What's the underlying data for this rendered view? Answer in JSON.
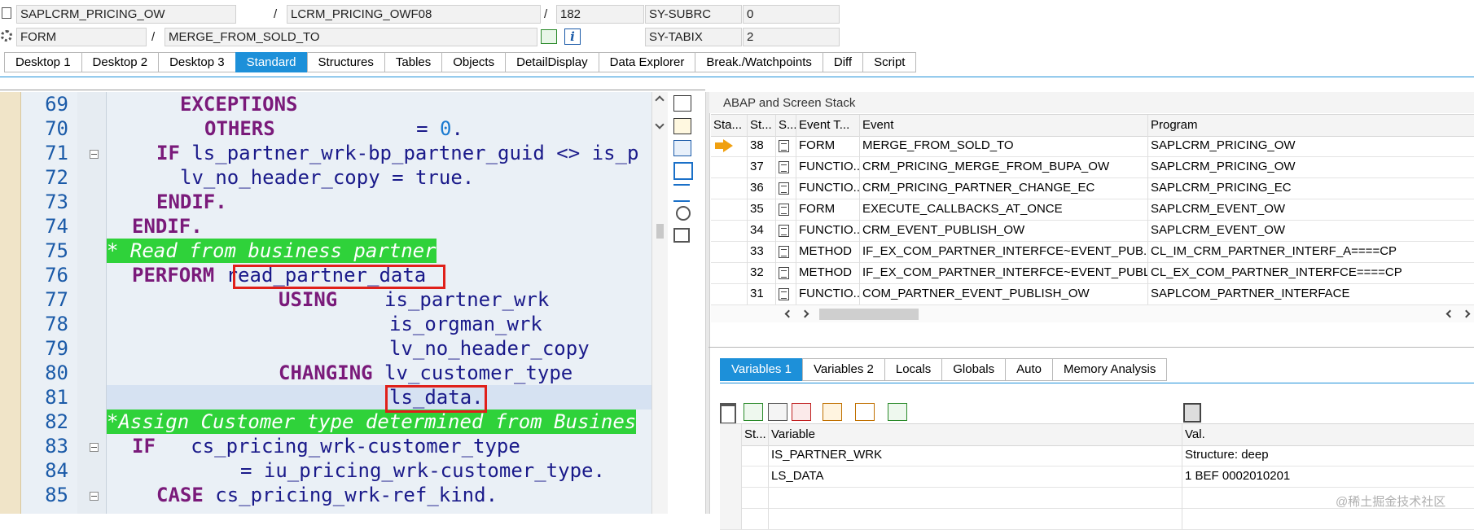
{
  "header": {
    "row1": {
      "program": "SAPLCRM_PRICING_OW",
      "include": "LCRM_PRICING_OWF08",
      "line": "182",
      "sysvar_label": "SY-SUBRC",
      "sysvar_value": "0"
    },
    "row2": {
      "type": "FORM",
      "name": "MERGE_FROM_SOLD_TO",
      "sysvar_label": "SY-TABIX",
      "sysvar_value": "2"
    },
    "slash": "/"
  },
  "tabs": [
    "Desktop 1",
    "Desktop 2",
    "Desktop 3",
    "Standard",
    "Structures",
    "Tables",
    "Objects",
    "DetailDisplay",
    "Data Explorer",
    "Break./Watchpoints",
    "Diff",
    "Script"
  ],
  "active_tab": "Standard",
  "code": {
    "lines": [
      {
        "n": "69",
        "t": "EXCEPTIONS"
      },
      {
        "n": "70",
        "t": "OTHERS            = 0."
      },
      {
        "n": "71",
        "t": "IF ls_partner_wrk-bp_partner_guid <> is_p"
      },
      {
        "n": "72",
        "t": "lv_no_header_copy = true."
      },
      {
        "n": "73",
        "t": "ENDIF."
      },
      {
        "n": "74",
        "t": "ENDIF."
      },
      {
        "n": "75",
        "t": "* Read from business partner"
      },
      {
        "n": "76",
        "t": "PERFORM read_partner_data"
      },
      {
        "n": "77",
        "t": "USING    is_partner_wrk"
      },
      {
        "n": "78",
        "t": "is_orgman_wrk"
      },
      {
        "n": "79",
        "t": "lv_no_header_copy"
      },
      {
        "n": "80",
        "t": "CHANGING lv_customer_type"
      },
      {
        "n": "81",
        "t": "ls_data."
      },
      {
        "n": "82",
        "t": "*Assign Customer type determined from Busines"
      },
      {
        "n": "83",
        "t": "IF   cs_pricing_wrk-customer_type"
      },
      {
        "n": "84",
        "t": "= iu_pricing_wrk-customer_type."
      },
      {
        "n": "85",
        "t": "CASE cs_pricing_wrk-ref_kind."
      }
    ],
    "kw": {
      "exceptions": "EXCEPTIONS",
      "others": "OTHERS",
      "others_rest": "            = ",
      "zero": "0",
      "dot": ".",
      "if": "IF",
      "if71_rest": " ls_partner_wrk-bp_partner_guid <> is_p",
      "l72": "lv_no_header_copy = true.",
      "endif": "ENDIF.",
      "c75": "* Read from business partner",
      "perform": "PERFORM",
      "form_name": "read_partner_data",
      "using": "USING",
      "using_rest": "    is_partner_wrk",
      "l78": "is_orgman_wrk",
      "l79": "lv_no_header_copy",
      "changing": "CHANGING",
      "changing_rest": " lv_customer_type",
      "l81": "ls_data.",
      "c82": "*Assign Customer type determined from Busines",
      "if83_rest": "   cs_pricing_wrk-customer_type",
      "l84": "= iu_pricing_wrk-customer_type.",
      "case": "CASE",
      "case_rest": " cs_pricing_wrk-ref_kind."
    }
  },
  "stack": {
    "title": "ABAP and Screen Stack",
    "columns": [
      "Sta...",
      "St...",
      "S...",
      "Event T...",
      "Event",
      "Program"
    ],
    "rows": [
      {
        "level": "38",
        "etype": "FORM",
        "event": "MERGE_FROM_SOLD_TO",
        "program": "SAPLCRM_PRICING_OW",
        "current": true
      },
      {
        "level": "37",
        "etype": "FUNCTIO...",
        "event": "CRM_PRICING_MERGE_FROM_BUPA_OW",
        "program": "SAPLCRM_PRICING_OW"
      },
      {
        "level": "36",
        "etype": "FUNCTIO...",
        "event": "CRM_PRICING_PARTNER_CHANGE_EC",
        "program": "SAPLCRM_PRICING_EC"
      },
      {
        "level": "35",
        "etype": "FORM",
        "event": "EXECUTE_CALLBACKS_AT_ONCE",
        "program": "SAPLCRM_EVENT_OW"
      },
      {
        "level": "34",
        "etype": "FUNCTIO...",
        "event": "CRM_EVENT_PUBLISH_OW",
        "program": "SAPLCRM_EVENT_OW"
      },
      {
        "level": "33",
        "etype": "METHOD",
        "event": "IF_EX_COM_PARTNER_INTERFCE~EVENT_PUB...",
        "program": "CL_IM_CRM_PARTNER_INTERF_A====CP"
      },
      {
        "level": "32",
        "etype": "METHOD",
        "event": "IF_EX_COM_PARTNER_INTERFCE~EVENT_PUBL",
        "program": "CL_EX_COM_PARTNER_INTERFCE====CP"
      },
      {
        "level": "31",
        "etype": "FUNCTIO...",
        "event": "COM_PARTNER_EVENT_PUBLISH_OW",
        "program": "SAPLCOM_PARTNER_INTERFACE"
      }
    ]
  },
  "var_tabs": [
    "Variables 1",
    "Variables 2",
    "Locals",
    "Globals",
    "Auto",
    "Memory Analysis"
  ],
  "active_var_tab": "Variables 1",
  "variables": {
    "columns": [
      "St...",
      "Variable",
      "Val."
    ],
    "rows": [
      {
        "name": "IS_PARTNER_WRK",
        "value": "Structure: deep"
      },
      {
        "name": "LS_DATA",
        "value": "1     BEF   0002010201"
      }
    ]
  },
  "watermark": "@稀土掘金技术社区",
  "colors": {
    "accent": "#1d90d9",
    "keyword": "#7a1a7a",
    "comment_bg": "#2fd23a",
    "highlight_box": "#e0201a",
    "stack_arrow": "#f0a010"
  }
}
